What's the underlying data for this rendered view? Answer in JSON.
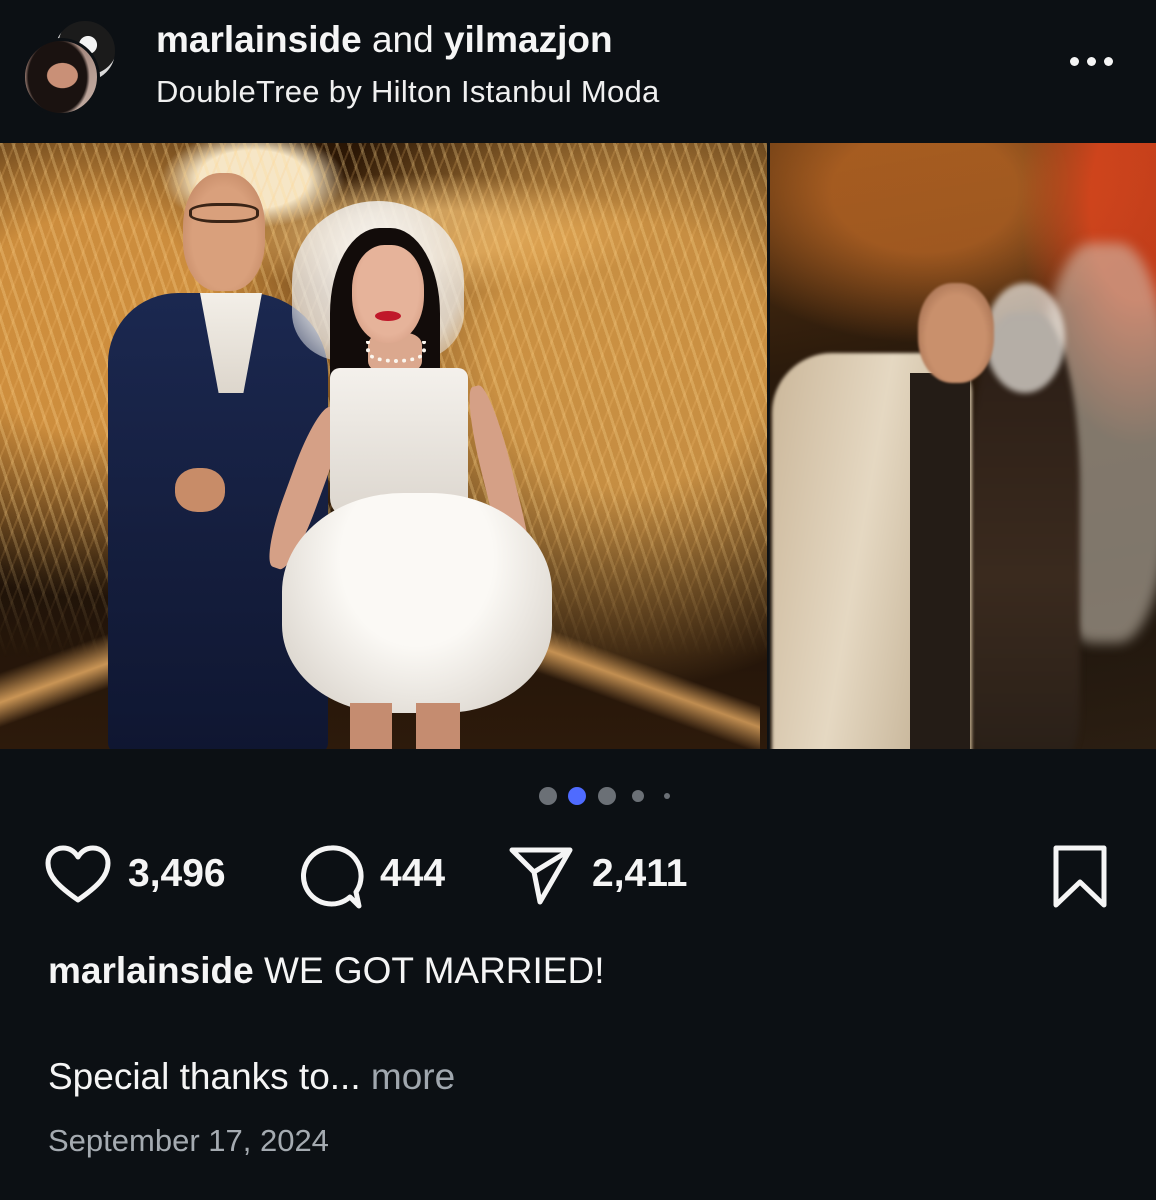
{
  "post": {
    "author": "marlainside",
    "author_joiner": "and",
    "coauthor": "yilmazjon",
    "location": "DoubleTree by Hilton Istanbul Moda"
  },
  "carousel": {
    "total_indicators": 5,
    "active_index": 1,
    "active_color": "#4f6bff"
  },
  "actions": {
    "like_icon": "heart-icon",
    "likes": "3,496",
    "comment_icon": "comment-icon",
    "comments": "444",
    "share_icon": "paper-plane-icon",
    "shares": "2,411",
    "save_icon": "bookmark-icon"
  },
  "caption": {
    "username": "marlainside",
    "text": "WE GOT MARRIED!",
    "second_line": "Special thanks to...",
    "more_label": "more"
  },
  "date": "September 17, 2024",
  "colors": {
    "background": "#0c1014",
    "text": "#f5f5f5",
    "muted": "#a5abb1"
  }
}
